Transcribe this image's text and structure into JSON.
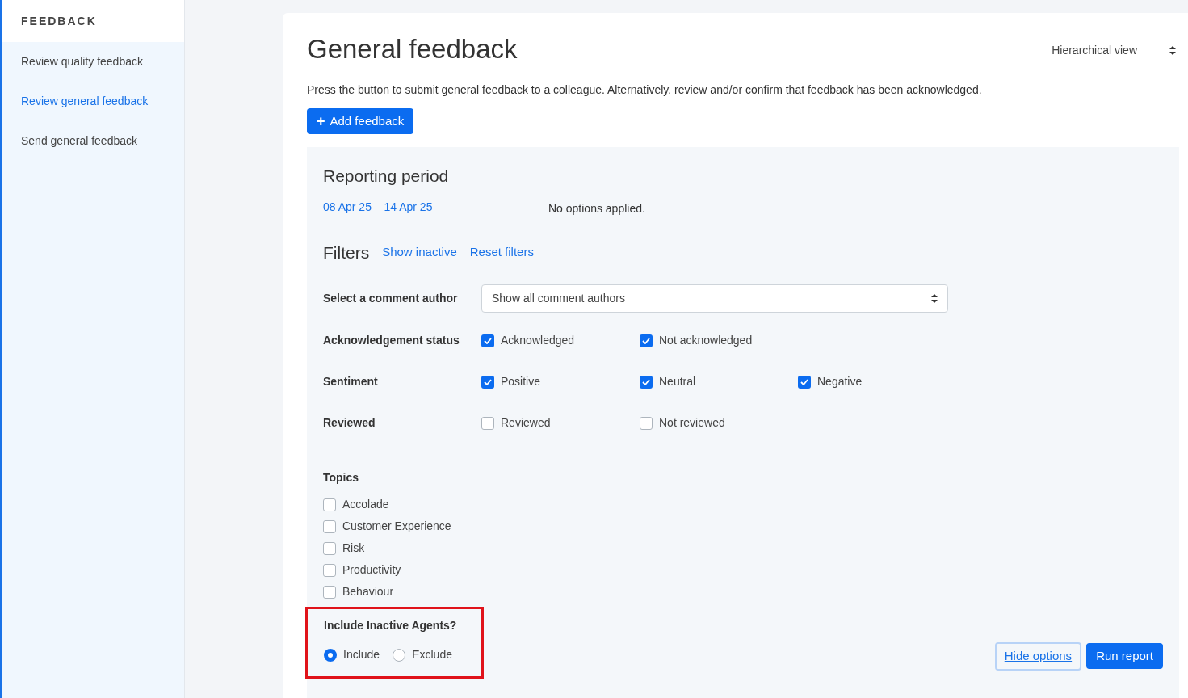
{
  "sidebar": {
    "heading": "FEEDBACK",
    "items": [
      {
        "label": "Review quality feedback",
        "selected": false
      },
      {
        "label": "Review general feedback",
        "selected": true
      },
      {
        "label": "Send general feedback",
        "selected": false
      }
    ]
  },
  "page": {
    "title": "General feedback",
    "view_select": {
      "value": "Hierarchical view"
    },
    "description": "Press the button to submit general feedback to a colleague. Alternatively, review and/or confirm that feedback has been acknowledged.",
    "add_button": {
      "icon": "+",
      "label": "Add feedback"
    }
  },
  "options": {
    "reporting_period": {
      "heading": "Reporting period",
      "range": "08 Apr 25 – 14 Apr 25",
      "summary": "No options applied."
    },
    "filters": {
      "heading": "Filters",
      "links": [
        "Show inactive",
        "Reset filters"
      ],
      "author": {
        "label": "Select a comment author",
        "value": "Show all comment authors"
      },
      "groups": [
        {
          "label": "Acknowledgement status",
          "options": [
            {
              "label": "Acknowledged",
              "checked": true
            },
            {
              "label": "Not acknowledged",
              "checked": true
            }
          ]
        },
        {
          "label": "Sentiment",
          "options": [
            {
              "label": "Positive",
              "checked": true
            },
            {
              "label": "Neutral",
              "checked": true
            },
            {
              "label": "Negative",
              "checked": true
            }
          ]
        },
        {
          "label": "Reviewed",
          "options": [
            {
              "label": "Reviewed",
              "checked": false
            },
            {
              "label": "Not reviewed",
              "checked": false
            }
          ]
        }
      ],
      "topics": {
        "label": "Topics",
        "options": [
          {
            "label": "Accolade",
            "checked": false
          },
          {
            "label": "Customer Experience",
            "checked": false
          },
          {
            "label": "Risk",
            "checked": false
          },
          {
            "label": "Productivity",
            "checked": false
          },
          {
            "label": "Behaviour",
            "checked": false
          }
        ]
      },
      "inactive_agents": {
        "label": "Include Inactive Agents?",
        "highlighted": true,
        "options": [
          {
            "label": "Include",
            "selected": true
          },
          {
            "label": "Exclude",
            "selected": false
          }
        ]
      }
    },
    "buttons": {
      "hide": "Hide options",
      "run": "Run report"
    }
  }
}
